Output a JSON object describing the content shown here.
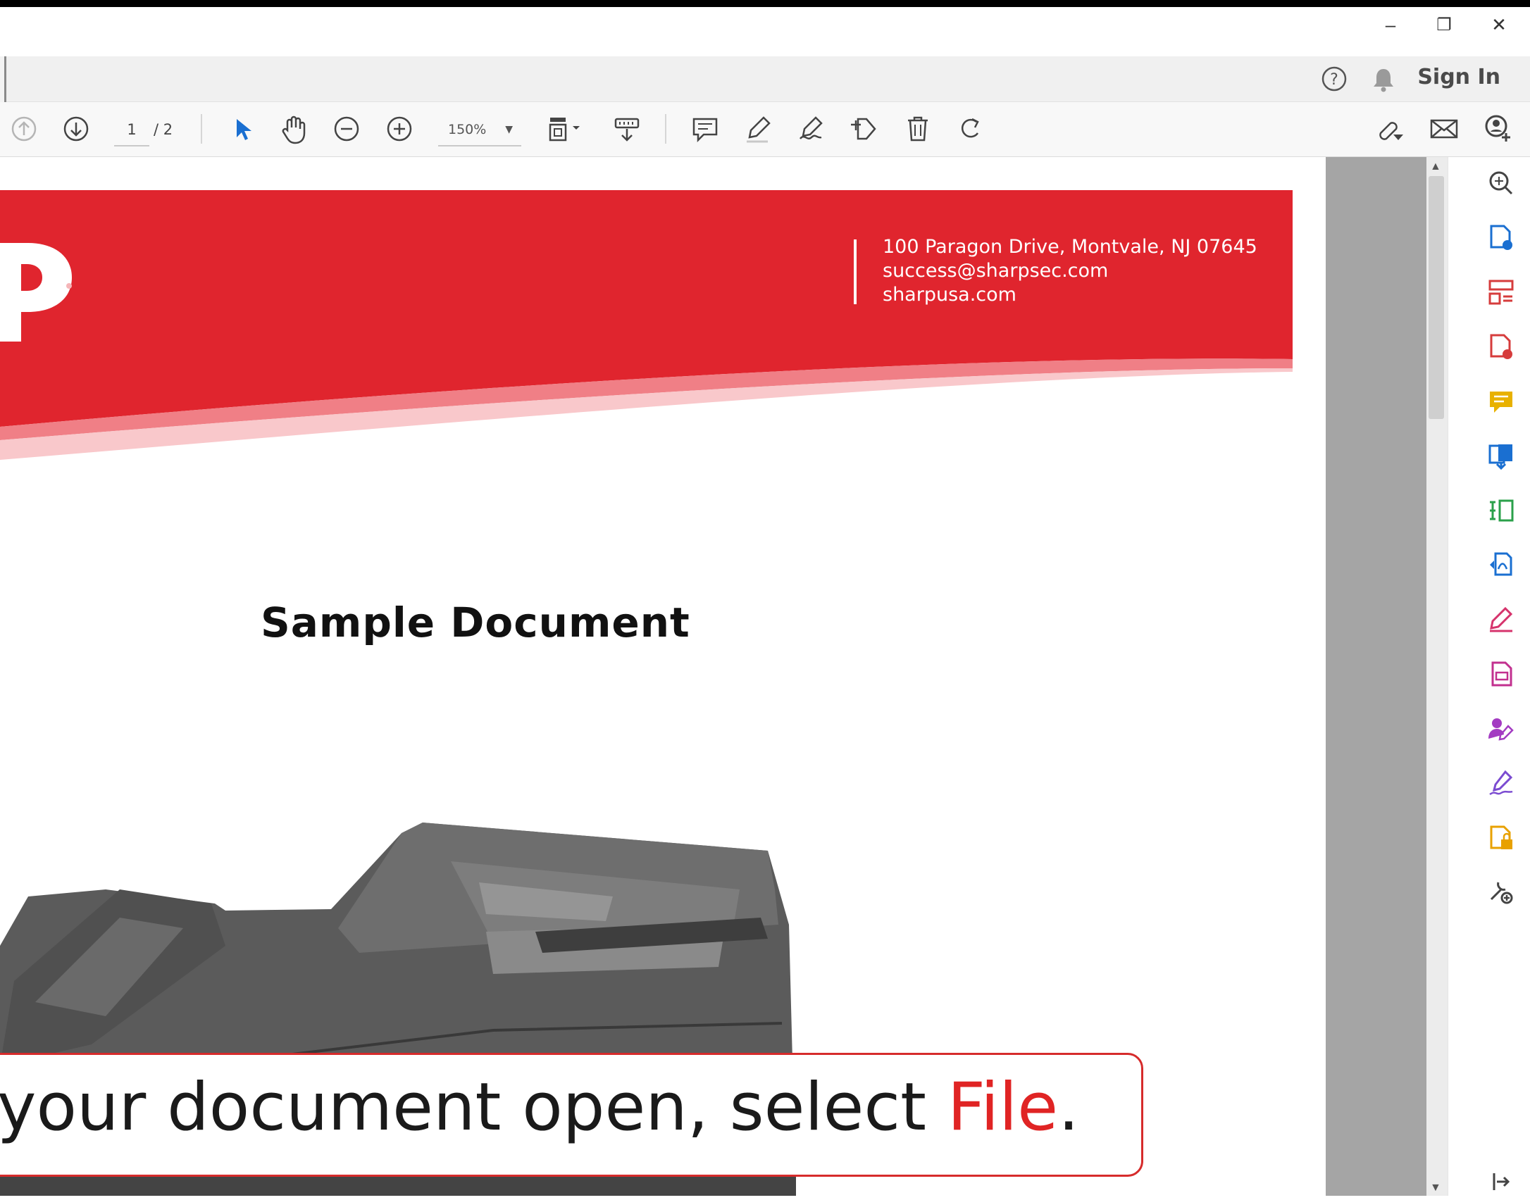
{
  "window": {
    "minimize": "–",
    "restore": "❐",
    "close": "✕"
  },
  "menubar": {
    "help_icon": "help-icon",
    "bell_icon": "bell-icon",
    "signin": "Sign In"
  },
  "toolbar": {
    "page_current": "1",
    "page_total": "/ 2",
    "zoom": "150%"
  },
  "document": {
    "header_address": "100 Paragon Drive, Montvale, NJ 07645",
    "header_email": "success@sharpsec.com",
    "header_web": "sharpusa.com",
    "logo_fragment": "P",
    "title": "Sample Document",
    "header_color": "#e0252e"
  },
  "caption": {
    "text_before": "h your document open, select ",
    "highlight": "File",
    "text_after": "."
  },
  "right_tools": [
    "zoom-icon",
    "create-pdf-icon",
    "organize-icon",
    "export-pdf-icon",
    "comment-icon",
    "combine-icon",
    "compress-icon",
    "convert-icon",
    "fill-sign-icon",
    "edit-pdf-icon",
    "request-sign-icon",
    "sign-icon",
    "protect-icon",
    "more-tools-icon"
  ]
}
